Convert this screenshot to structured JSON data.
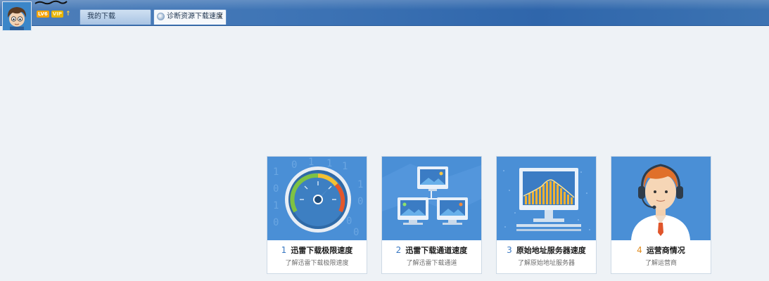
{
  "user": {
    "level_badge": "LV6",
    "vip_badge": "VIP",
    "level_up_arrow": "↑"
  },
  "tabs": [
    {
      "label": "我的下载"
    },
    {
      "label": "诊断资源下载速度",
      "close": "×"
    }
  ],
  "cards": [
    {
      "number": "1",
      "number_color": "#3a78c2",
      "title": "迅雷下载极限速度",
      "subtitle": "了解迅雷下载极限速度",
      "icon": "speedometer-icon"
    },
    {
      "number": "2",
      "number_color": "#3a78c2",
      "title": "迅雷下载通道速度",
      "subtitle": "了解迅雷下载通道",
      "icon": "network-monitors-icon"
    },
    {
      "number": "3",
      "number_color": "#3a78c2",
      "title": "原始地址服务器速度",
      "subtitle": "了解原始地址服务器",
      "icon": "server-chart-icon"
    },
    {
      "number": "4",
      "number_color": "#e08a1c",
      "title": "运营商情况",
      "subtitle": "了解运营商",
      "icon": "support-agent-icon"
    }
  ],
  "colors": {
    "topbar": "#3f75b6",
    "background": "#eef2f6",
    "card_image": "#4a8fd6"
  }
}
